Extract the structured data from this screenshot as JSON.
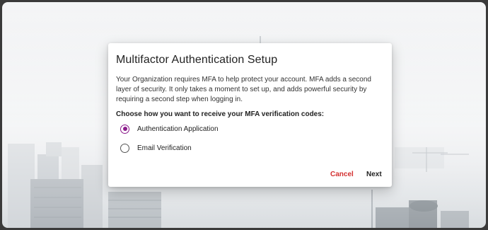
{
  "dialog": {
    "title": "Multifactor Authentication Setup",
    "description": "Your Organization requires MFA to help protect your account. MFA adds a second layer of security. It only takes a moment to set up, and adds powerful security by requiring a second step when logging in.",
    "choose_label": "Choose how you want to receive your MFA verification codes:",
    "options": [
      {
        "label": "Authentication Application",
        "selected": true
      },
      {
        "label": "Email Verification",
        "selected": false
      }
    ],
    "cancel_label": "Cancel",
    "next_label": "Next"
  },
  "colors": {
    "accent": "#8b1a8b",
    "cancel": "#d32f2f"
  }
}
